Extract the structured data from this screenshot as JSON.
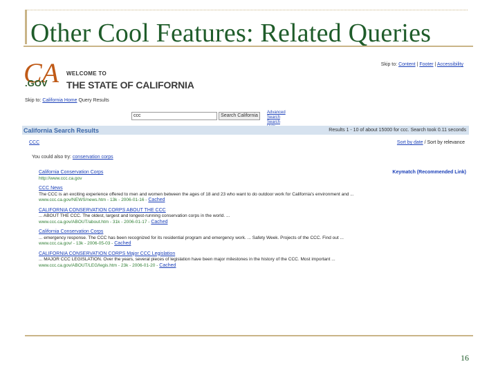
{
  "slide": {
    "title": "Other Cool Features: Related Queries",
    "page_number": "16"
  },
  "site": {
    "logo_ca": "CA",
    "logo_gov": ".GOV",
    "welcome": "WELCOME TO",
    "state_name": "THE STATE OF CALIFORNIA",
    "skip_prefix": "Skip to:",
    "skip_links": [
      "Content",
      "Footer",
      "Accessibility"
    ],
    "crumb_prefix": "Skip to:",
    "crumb_home": "California Home",
    "crumb_current": "Query Results"
  },
  "search": {
    "query": "ccc",
    "button_label": "Search California",
    "advanced_label": "Advanced Search",
    "help_label": "Search Help"
  },
  "results_header": {
    "title": "California Search Results",
    "count_text": "Results 1 - 10 of about 15000 for ccc. Search took 0.11 seconds"
  },
  "sort": {
    "left_link": "CCC",
    "sort_by_date": "Sort by date",
    "sort_by_relevance": "Sort by relevance"
  },
  "related": {
    "prefix": "You could also try:",
    "link": "conservation corps"
  },
  "keymatch_label": "Keymatch (Recommended Link)",
  "results": [
    {
      "title": "California Conservation Corps",
      "snippet": "",
      "url": "http://www.ccc.ca.gov",
      "cache": ""
    },
    {
      "title": "CCC News",
      "snippet": "The CCC is an exciting experience offered to men and women between the ages of 18 and 23 who want to do outdoor work for California's environment and ...",
      "url": "www.ccc.ca.gov/NEWS/news.htm - 13k - 2006-01-16 -",
      "cache": "Cached"
    },
    {
      "title": "CALIFORNIA CONSERVATION CORPS ABOUT THE CCC",
      "snippet": "... ABOUT THE CCC. The oldest, largest and longest-running conservation corps in the world. ...",
      "url": "www.ccc.ca.gov/ABOUT/about.htm - 31k - 2006-01-17 -",
      "cache": "Cached"
    },
    {
      "title": "California Conservation Corps",
      "snippet": "... emergency response. The CCC has been recognized for its residential program and emergency work. ... Safety Week. Projects of the CCC. Find out ...",
      "url": "www.ccc.ca.gov/ - 13k - 2006-05-03 -",
      "cache": "Cached"
    },
    {
      "title": "CALIFORNIA CONSERVATION CORPS Major CCC Legislation",
      "snippet": "... MAJOR CCC LEGISLATION. Over the years, several pieces of legislation have been major milestones in the history of the CCC. Most important ...",
      "url": "www.ccc.ca.gov/ABOUT/LEG/legis.htm - 23k - 2006-01-20 -",
      "cache": "Cached"
    }
  ],
  "colors": {
    "title_green": "#1f5c2a",
    "rule_tan": "#c9b487",
    "ca_orange": "#c05a17",
    "link_blue": "#1a3fb8",
    "header_bar": "#d6e2ef"
  }
}
